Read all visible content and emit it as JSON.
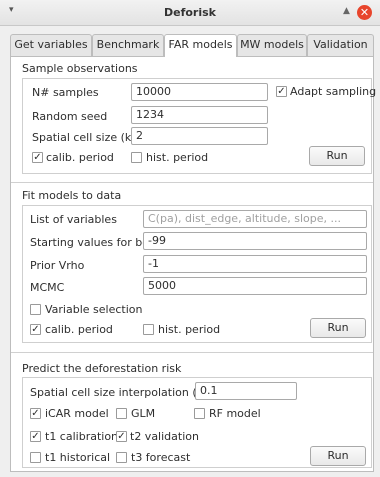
{
  "window": {
    "title": "Deforisk",
    "menu_icon": "chevron-down-icon",
    "up_icon": "triangle-up-icon",
    "close_icon": "close-icon",
    "close_color": "#e8452c"
  },
  "tabs": [
    {
      "label": "Get variables"
    },
    {
      "label": "Benchmark"
    },
    {
      "label": "FAR models"
    },
    {
      "label": "MW models"
    },
    {
      "label": "Validation"
    }
  ],
  "active_tab": "FAR models",
  "sample": {
    "title": "Sample observations",
    "n_samples_label": "N# samples",
    "n_samples_value": "10000",
    "adapt_label": "Adapt sampling",
    "adapt_checked": true,
    "seed_label": "Random seed",
    "seed_value": "1234",
    "cell_label": "Spatial cell size (km)",
    "cell_value": "2",
    "calib_label": "calib. period",
    "calib_checked": true,
    "hist_label": "hist. period",
    "hist_checked": false,
    "run_label": "Run"
  },
  "fit": {
    "title": "Fit models to data",
    "vars_label": "List of variables",
    "vars_placeholder": "C(pa), dist_edge, altitude, slope, ...",
    "beta_label": "Starting values for beta",
    "beta_value": "-99",
    "vrho_label": "Prior Vrho",
    "vrho_value": "-1",
    "mcmc_label": "MCMC",
    "mcmc_value": "5000",
    "varsel_label": "Variable selection",
    "varsel_checked": false,
    "calib_label": "calib. period",
    "calib_checked": true,
    "hist_label": "hist. period",
    "hist_checked": false,
    "run_label": "Run"
  },
  "predict": {
    "title": "Predict the deforestation risk",
    "interp_label": "Spatial cell size interpolation (km)",
    "interp_value": "0.1",
    "icar_label": "iCAR model",
    "icar_checked": true,
    "glm_label": "GLM",
    "glm_checked": false,
    "rf_label": "RF model",
    "rf_checked": false,
    "t1cal_label": "t1 calibration",
    "t1cal_checked": true,
    "t2val_label": "t2 validation",
    "t2val_checked": true,
    "t1hist_label": "t1 historical",
    "t1hist_checked": false,
    "t3fc_label": "t3 forecast",
    "t3fc_checked": false,
    "run_label": "Run"
  }
}
